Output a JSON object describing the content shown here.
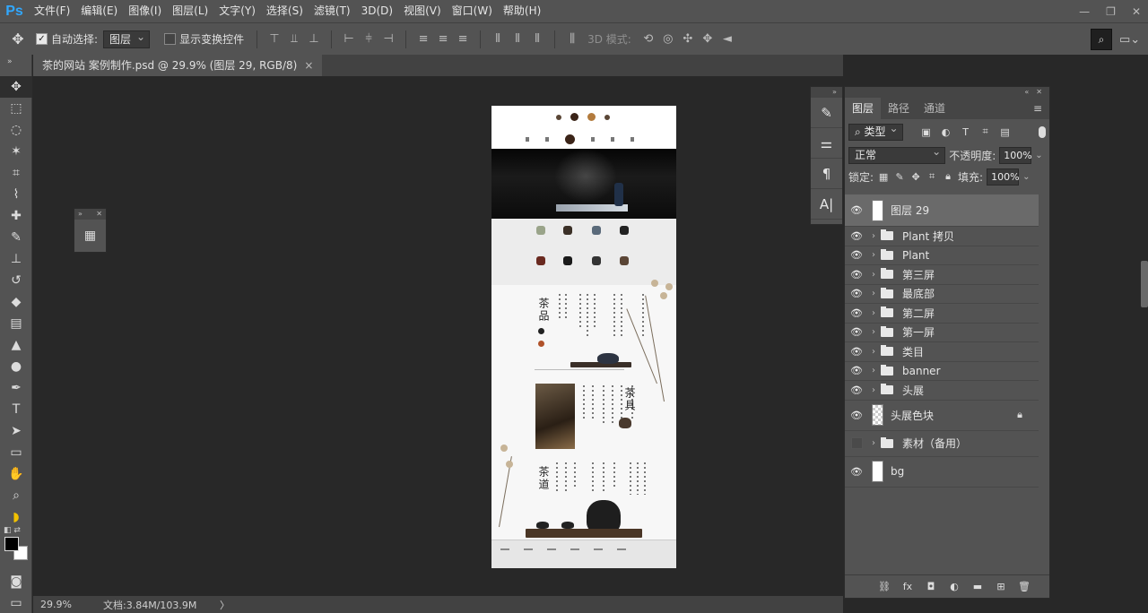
{
  "app": {
    "logo": "Ps",
    "menu": [
      "文件(F)",
      "编辑(E)",
      "图像(I)",
      "图层(L)",
      "文字(Y)",
      "选择(S)",
      "滤镜(T)",
      "3D(D)",
      "视图(V)",
      "窗口(W)",
      "帮助(H)"
    ],
    "window_controls": [
      "—",
      "❐",
      "✕"
    ]
  },
  "options": {
    "auto_select_label": "自动选择:",
    "auto_select_checked": true,
    "auto_select_value": "图层",
    "show_transform_label": "显示变换控件",
    "mode_3d_label": "3D 模式:"
  },
  "document": {
    "tab_title": "茶的网站 案例制作.psd @ 29.9% (图层 29, RGB/8)",
    "tab_close": "×",
    "page_section_titles": [
      "茶品",
      "茶具",
      "茶道"
    ]
  },
  "layers_panel": {
    "tabs": [
      "图层",
      "路径",
      "通道"
    ],
    "active_tab": "图层",
    "filter_kind": "类型",
    "blend_mode": "正常",
    "opacity_label": "不透明度:",
    "opacity_value": "100%",
    "lock_label": "锁定:",
    "fill_label": "填充:",
    "fill_value": "100%",
    "layers": [
      {
        "name": "图层 29",
        "kind": "layer",
        "visible": true,
        "selected": true
      },
      {
        "name": "Plant 拷贝",
        "kind": "group",
        "visible": true
      },
      {
        "name": "Plant",
        "kind": "group",
        "visible": true
      },
      {
        "name": "第三屏",
        "kind": "group",
        "visible": true
      },
      {
        "name": "最底部",
        "kind": "group",
        "visible": true
      },
      {
        "name": "第二屏",
        "kind": "group",
        "visible": true
      },
      {
        "name": "第一屏",
        "kind": "group",
        "visible": true
      },
      {
        "name": "类目",
        "kind": "group",
        "visible": true
      },
      {
        "name": "banner",
        "kind": "group",
        "visible": true
      },
      {
        "name": "头展",
        "kind": "group",
        "visible": true
      },
      {
        "name": "头展色块",
        "kind": "layer",
        "visible": true,
        "locked": true
      },
      {
        "name": "素材（备用）",
        "kind": "group",
        "visible": false
      },
      {
        "name": "bg",
        "kind": "layer",
        "visible": true
      }
    ]
  },
  "status": {
    "zoom": "29.9%",
    "doc_size": "文档:3.84M/103.9M",
    "arrow": "〉"
  },
  "colors": {
    "accent": "#31a8ff",
    "panel_bg": "#535353",
    "canvas_bg": "#282828",
    "selected_layer": "#6a6a6a"
  }
}
